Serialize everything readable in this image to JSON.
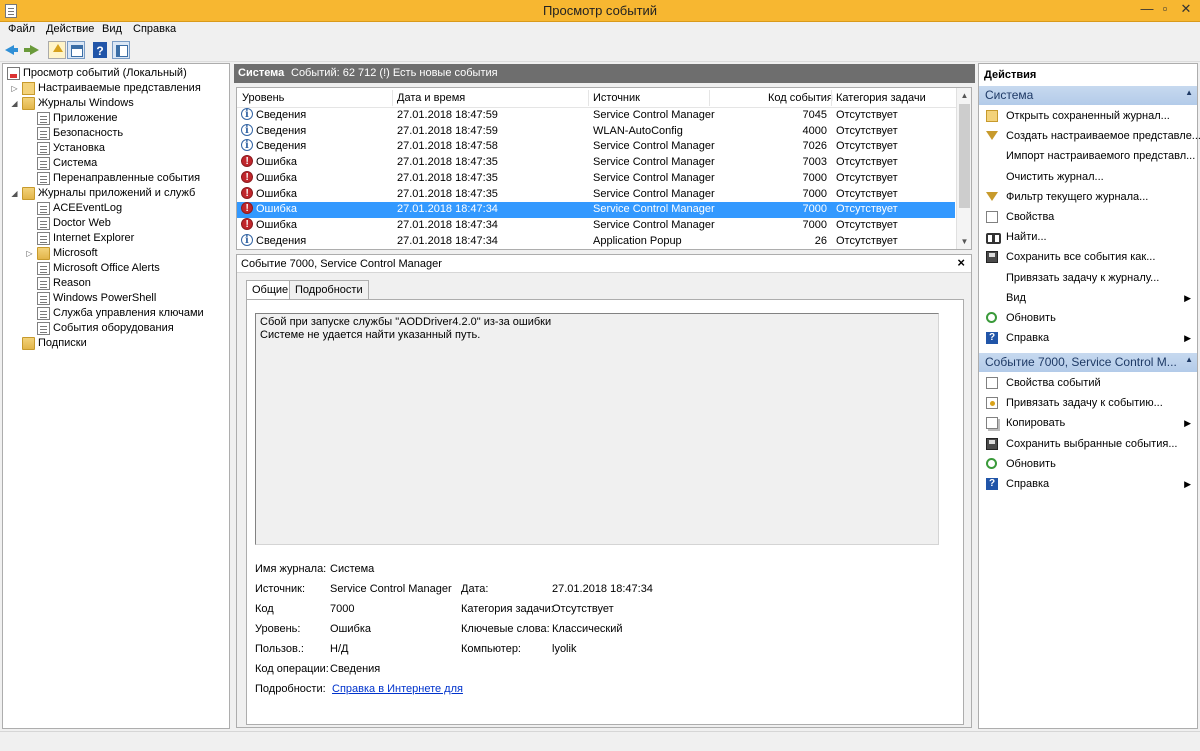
{
  "window": {
    "title": "Просмотр событий"
  },
  "menu": [
    "Файл",
    "Действие",
    "Вид",
    "Справка"
  ],
  "tree": [
    {
      "label": "Просмотр событий (Локальный)",
      "level": 0,
      "icon": "root-icon"
    },
    {
      "label": "Настраиваемые представления",
      "level": 1,
      "icon": "folder-icon",
      "expander": "▷"
    },
    {
      "label": "Журналы Windows",
      "level": 1,
      "icon": "folder-icon",
      "expander": "◢"
    },
    {
      "label": "Приложение",
      "level": 2,
      "icon": "log-icon"
    },
    {
      "label": "Безопасность",
      "level": 2,
      "icon": "log-icon"
    },
    {
      "label": "Установка",
      "level": 2,
      "icon": "log-icon"
    },
    {
      "label": "Система",
      "level": 2,
      "icon": "log-icon"
    },
    {
      "label": "Перенаправленные события",
      "level": 2,
      "icon": "log-icon"
    },
    {
      "label": "Журналы приложений и служб",
      "level": 1,
      "icon": "folder-icon",
      "expander": "◢"
    },
    {
      "label": "ACEEventLog",
      "level": 2,
      "icon": "log-icon"
    },
    {
      "label": "Doctor Web",
      "level": 2,
      "icon": "log-icon"
    },
    {
      "label": "Internet Explorer",
      "level": 2,
      "icon": "log-icon"
    },
    {
      "label": "Microsoft",
      "level": 2,
      "icon": "folder-icon",
      "expander": "▷"
    },
    {
      "label": "Microsoft Office Alerts",
      "level": 2,
      "icon": "log-icon"
    },
    {
      "label": "Reason",
      "level": 2,
      "icon": "log-icon"
    },
    {
      "label": "Windows PowerShell",
      "level": 2,
      "icon": "log-icon"
    },
    {
      "label": "Служба управления ключами",
      "level": 2,
      "icon": "log-icon"
    },
    {
      "label": "События оборудования",
      "level": 2,
      "icon": "log-icon"
    },
    {
      "label": "Подписки",
      "level": 1,
      "icon": "folder-icon"
    }
  ],
  "center": {
    "log_name": "Система",
    "info": "Событий: 62 712 (!) Есть новые события",
    "columns": [
      "Уровень",
      "Дата и время",
      "Источник",
      "Код события",
      "Категория задачи"
    ],
    "rows": [
      {
        "level": "Сведения",
        "type": "info",
        "datetime": "27.01.2018 18:47:59",
        "source": "Service Control Manager",
        "code": "7045",
        "category": "Отсутствует"
      },
      {
        "level": "Сведения",
        "type": "info",
        "datetime": "27.01.2018 18:47:59",
        "source": "WLAN-AutoConfig",
        "code": "4000",
        "category": "Отсутствует"
      },
      {
        "level": "Сведения",
        "type": "info",
        "datetime": "27.01.2018 18:47:58",
        "source": "Service Control Manager",
        "code": "7026",
        "category": "Отсутствует"
      },
      {
        "level": "Ошибка",
        "type": "err",
        "datetime": "27.01.2018 18:47:35",
        "source": "Service Control Manager",
        "code": "7003",
        "category": "Отсутствует"
      },
      {
        "level": "Ошибка",
        "type": "err",
        "datetime": "27.01.2018 18:47:35",
        "source": "Service Control Manager",
        "code": "7000",
        "category": "Отсутствует"
      },
      {
        "level": "Ошибка",
        "type": "err",
        "datetime": "27.01.2018 18:47:35",
        "source": "Service Control Manager",
        "code": "7000",
        "category": "Отсутствует"
      },
      {
        "level": "Ошибка",
        "type": "err",
        "datetime": "27.01.2018 18:47:34",
        "source": "Service Control Manager",
        "code": "7000",
        "category": "Отсутствует",
        "selected": true
      },
      {
        "level": "Ошибка",
        "type": "err",
        "datetime": "27.01.2018 18:47:34",
        "source": "Service Control Manager",
        "code": "7000",
        "category": "Отсутствует"
      },
      {
        "level": "Сведения",
        "type": "info",
        "datetime": "27.01.2018 18:47:34",
        "source": "Application Popup",
        "code": "26",
        "category": "Отсутствует"
      }
    ]
  },
  "detail": {
    "title": "Событие 7000, Service Control Manager",
    "close": "×",
    "tabs": [
      "Общие",
      "Подробности"
    ],
    "description_line1": "Сбой при запуске службы \"AODDriver4.2.0\" из-за ошибки",
    "description_line2": "Системе не удается найти указанный путь.",
    "fields": {
      "log_label": "Имя журнала:",
      "log_value": "Система",
      "source_label": "Источник:",
      "source_value": "Service Control Manager",
      "date_label": "Дата:",
      "date_value": "27.01.2018 18:47:34",
      "code_label": "Код",
      "code_value": "7000",
      "category_label": "Категория задачи:",
      "category_value": "Отсутствует",
      "level_label": "Уровень:",
      "level_value": "Ошибка",
      "keywords_label": "Ключевые слова:",
      "keywords_value": "Классический",
      "user_label": "Пользов.:",
      "user_value": "Н/Д",
      "computer_label": "Компьютер:",
      "computer_value": "lyolik",
      "opcode_label": "Код операции:",
      "opcode_value": "Сведения",
      "more_label": "Подробности:",
      "more_link": "Справка в Интернете для"
    }
  },
  "actions": {
    "title": "Действия",
    "section1": "Система",
    "section1_items": [
      {
        "label": "Открыть сохраненный журнал...",
        "icon": "open-folder-icon"
      },
      {
        "label": "Создать настраиваемое представле...",
        "icon": "filter-icon"
      },
      {
        "label": "Импорт настраиваемого представл...",
        "icon": ""
      },
      {
        "label": "Очистить журнал...",
        "icon": ""
      },
      {
        "label": "Фильтр текущего журнала...",
        "icon": "filter-icon"
      },
      {
        "label": "Свойства",
        "icon": "properties-icon"
      },
      {
        "label": "Найти...",
        "icon": "find-icon"
      },
      {
        "label": "Сохранить все события как...",
        "icon": "save-icon"
      },
      {
        "label": "Привязать задачу к журналу...",
        "icon": ""
      },
      {
        "label": "Вид",
        "icon": "",
        "arrow": "▶"
      },
      {
        "label": "Обновить",
        "icon": "refresh-icon"
      },
      {
        "label": "Справка",
        "icon": "help-icon",
        "arrow": "▶"
      }
    ],
    "section2": "Событие 7000, Service Control M...",
    "section2_items": [
      {
        "label": "Свойства событий",
        "icon": "properties-icon"
      },
      {
        "label": "Привязать задачу к событию...",
        "icon": "task-icon"
      },
      {
        "label": "Копировать",
        "icon": "copy-icon",
        "arrow": "▶"
      },
      {
        "label": "Сохранить выбранные события...",
        "icon": "save-icon"
      },
      {
        "label": "Обновить",
        "icon": "refresh-icon"
      },
      {
        "label": "Справка",
        "icon": "help-icon",
        "arrow": "▶"
      }
    ],
    "collapse": "▲"
  },
  "colors": {
    "titlebar": "#f7b731",
    "selection": "#3399ff",
    "section_header": "#c7d9ef",
    "center_header": "#6e6e6e"
  }
}
